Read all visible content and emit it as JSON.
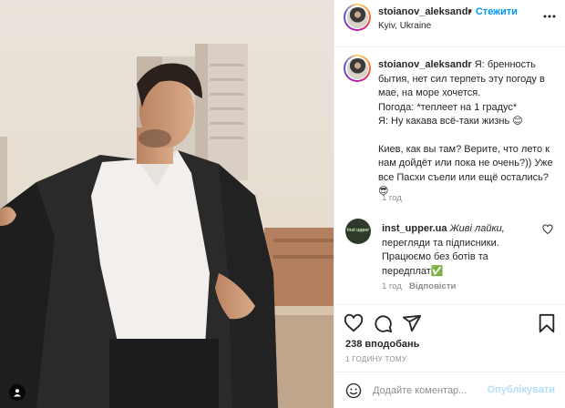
{
  "post": {
    "username": "stoianov_aleksandr",
    "follow_label": "Стежити",
    "location": "Kyiv, Ukraine",
    "caption": {
      "username": "stoianov_aleksandr",
      "lines": [
        "Я: бренность бытия, нет сил терпеть эту погоду в мае, на море хочется.",
        "Погода: *теплеет на 1 градус*",
        "Я: Ну какава всё-таки жизнь 😊",
        "",
        "Киев, как вы там? Верите, что лето к нам дойдёт или пока не очень?)) Уже все Пасхи съели или ещё остались?😎"
      ],
      "time": "1 год"
    },
    "comment": {
      "avatar_text": "inst upper",
      "username": "inst_upper.ua",
      "text_italic": "Живі лайки,",
      "text": "перегляди та підписники. Працюємо без ботів та передплат✅",
      "time": "1 год",
      "reply_label": "Відповісти"
    },
    "likes": "238 вподобань",
    "posted_ago": "1 ГОДИНУ ТОМУ",
    "add_comment": {
      "placeholder": "Додайте коментар...",
      "publish_label": "Опублікувати"
    },
    "icons": [
      "more-icon",
      "heart-icon",
      "comment-icon",
      "share-icon",
      "bookmark-icon",
      "emoji-icon",
      "user-tag-icon"
    ],
    "colors": {
      "accent": "#0095f6",
      "publish_disabled": "#b2dffc",
      "muted": "#8e8e8e",
      "text": "#262626"
    }
  }
}
